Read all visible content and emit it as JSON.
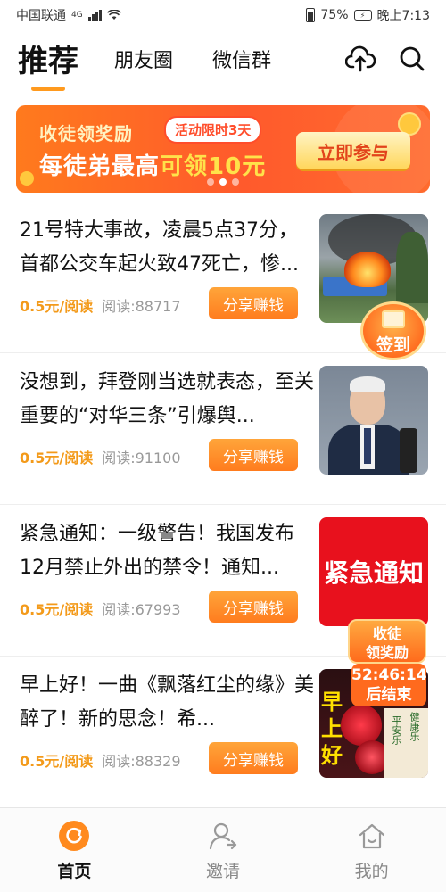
{
  "status_bar": {
    "carrier": "中国联通",
    "network": "4G",
    "battery": "75%",
    "time": "晚上7:13"
  },
  "top_tabs": [
    {
      "label": "推荐",
      "active": true
    },
    {
      "label": "朋友圈",
      "active": false
    },
    {
      "label": "微信群",
      "active": false
    }
  ],
  "top_icons": [
    "upload-cloud-icon",
    "search-icon"
  ],
  "banner": {
    "line1": "收徒领奖励",
    "tag": "活动限时3天",
    "line2_prefix": "每徒弟最高",
    "line2_highlight": "可领10元",
    "cta": "立即参与",
    "dots": 3,
    "active_dot": 1
  },
  "articles": [
    {
      "title": "21号特大事故，凌晨5点37分，首都公交车起火致47死亡，惨...",
      "rate": "0.5元/阅读",
      "reads": "阅读:88717",
      "share": "分享赚钱",
      "thumb": "bus-fire-photo"
    },
    {
      "title": "没想到，拜登刚当选就表态，至关重要的“对华三条”引爆舆...",
      "rate": "0.5元/阅读",
      "reads": "阅读:91100",
      "share": "分享赚钱",
      "thumb": "speaker-photo"
    },
    {
      "title": "紧急通知：一级警告！我国发布12月禁止外出的禁令！通知...",
      "rate": "0.5元/阅读",
      "reads": "阅读:67993",
      "share": "分享赚钱",
      "thumb": "紧急通知"
    },
    {
      "title": "早上好！一曲《飘落红尘的缘》美醉了！新的思念！希...",
      "rate": "0.5元/阅读",
      "reads": "阅读:88329",
      "share": "分享赚钱",
      "thumb": "morning-greeting-card"
    }
  ],
  "thumb_text": {
    "alert": "紧急通知",
    "morning": "早上好",
    "panel1": "平安乐",
    "panel2": "健康乐"
  },
  "checkin": {
    "label": "签到"
  },
  "recruit": {
    "line1": "收徒",
    "line2": "领奖励",
    "countdown": "52:46:14",
    "suffix": "后结束"
  },
  "bottom_nav": [
    {
      "label": "首页",
      "icon": "home-refresh-icon",
      "active": true
    },
    {
      "label": "邀请",
      "icon": "invite-user-icon",
      "active": false
    },
    {
      "label": "我的",
      "icon": "profile-house-icon",
      "active": false
    }
  ],
  "colors": {
    "accent": "#ff8a1e",
    "price": "#f39a1a",
    "alert_red": "#e8111d"
  }
}
